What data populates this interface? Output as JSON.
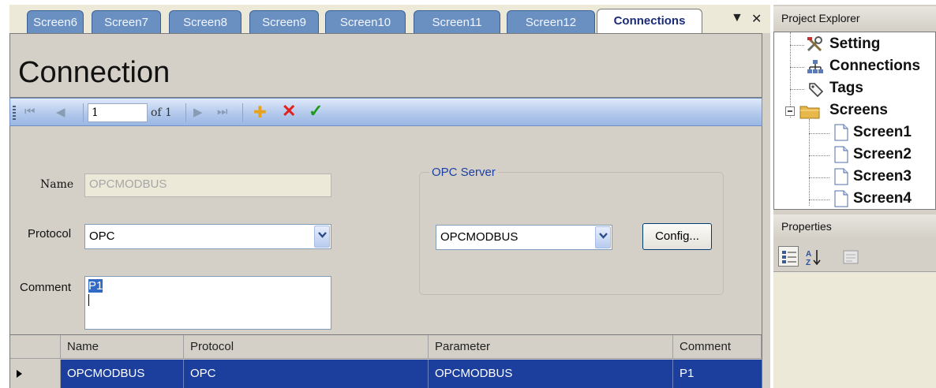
{
  "tabs": [
    "Screen6",
    "Screen7",
    "Screen8",
    "Screen9",
    "Screen10",
    "Screen11",
    "Screen12",
    "Connections"
  ],
  "active_tab": "Connections",
  "tab_controls": {
    "dropdown": "▼",
    "close": "✕"
  },
  "page_title": "Connection",
  "navigator": {
    "position": "1",
    "of_label": "of 1",
    "first": "⏮",
    "prev": "◀",
    "next": "▶",
    "last": "⏭",
    "add": "✚",
    "delete": "✕",
    "save": "✓"
  },
  "form": {
    "name_label": "Name",
    "name_value": "OPCMODBUS",
    "protocol_label": "Protocol",
    "protocol_value": "OPC",
    "comment_label": "Comment",
    "comment_value": "P1",
    "opc_group_title": "OPC Server",
    "opc_server_value": "OPCMODBUS",
    "config_button": "Config..."
  },
  "grid": {
    "columns": [
      "Name",
      "Protocol",
      "Parameter",
      "Comment"
    ],
    "rows": [
      {
        "name": "OPCMODBUS",
        "protocol": "OPC",
        "parameter": "OPCMODBUS",
        "comment": "P1"
      }
    ]
  },
  "project_explorer": {
    "title": "Project Explorer",
    "items": {
      "setting": "Setting",
      "connections": "Connections",
      "tags": "Tags",
      "screens": "Screens",
      "screen_children": [
        "Screen1",
        "Screen2",
        "Screen3",
        "Screen4"
      ]
    }
  },
  "properties": {
    "title": "Properties"
  },
  "colors": {
    "tab_inactive": "#6a8fc1",
    "selection": "#1c3f9e",
    "group_title": "#1c3fa6",
    "delete_red": "#e0201b",
    "save_green": "#1f9a1f",
    "add_orange": "#e9a21d"
  }
}
